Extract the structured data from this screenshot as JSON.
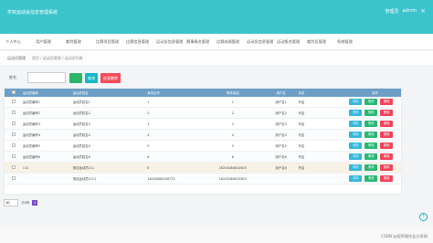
{
  "header": {
    "app_title": "学校运动会信息管理系统",
    "admin_label": "管理员",
    "user_label": "admin",
    "close_glyph": "×"
  },
  "nav": {
    "items": [
      "个人中心",
      "用户管理",
      "裁判管理",
      "比赛项目管理",
      "比赛信息管理",
      "运动员信息管理",
      "赛事报名管理",
      "比赛成绩管理",
      "运动员信息管理",
      "运动报名管理",
      "裁判员管理",
      "系统管理"
    ]
  },
  "breadcrumb": {
    "section": "运动员管理",
    "path": "首页 / 运动员管理 / 运动员列表"
  },
  "search": {
    "label": "姓名",
    "placeholder": "",
    "search_label": "查询",
    "batch_delete_label": "批量删除"
  },
  "table": {
    "headers": [
      "运动员编号",
      "运动员姓名",
      "身份证号",
      "联系电话",
      "用户名",
      "状态",
      "操作"
    ],
    "rows": [
      {
        "id": "运动员编号1",
        "name": "运动员姓名1",
        "invite": "1",
        "phone": "1",
        "user": "用户名1",
        "status": "开启"
      },
      {
        "id": "运动员编号2",
        "name": "运动员姓名2",
        "invite": "2",
        "phone": "2",
        "user": "用户名2",
        "status": "开启"
      },
      {
        "id": "运动员编号3",
        "name": "运动员姓名3",
        "invite": "3",
        "phone": "3",
        "user": "用户名3",
        "status": "开启"
      },
      {
        "id": "运动员编号4",
        "name": "运动员姓名4",
        "invite": "4",
        "phone": "4",
        "user": "用户名4",
        "status": "开启"
      },
      {
        "id": "运动员编号5",
        "name": "运动员姓名5",
        "invite": "5",
        "phone": "5",
        "user": "用户名5",
        "status": "开启"
      },
      {
        "id": "运动员编号6",
        "name": "运动员姓名6",
        "invite": "6",
        "phone": "6",
        "user": "用户名6",
        "status": "开启"
      },
      {
        "id": "111",
        "name": "测试运动员111",
        "invite": "6",
        "phone": "16243084810623",
        "user": "用户名6",
        "status": "开启"
      },
      {
        "id": "",
        "name": "测试运动员1111",
        "invite": "16243084049773",
        "phone": "16243084010623",
        "user": "",
        "status": ""
      }
    ],
    "ops": {
      "view": "详情",
      "edit": "修改",
      "delete": "删除"
    }
  },
  "pagination": {
    "page_size": "10",
    "total": "共8条",
    "current": "1"
  },
  "scroll_top_glyph": "↑",
  "watermark": "CSDN @程序猿毕业分享网"
}
